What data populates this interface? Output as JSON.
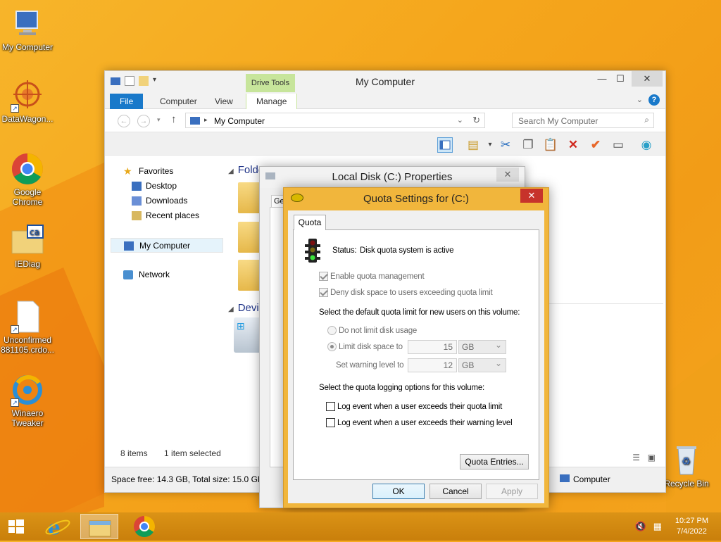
{
  "desktop": {
    "icons": [
      {
        "label": "My Computer"
      },
      {
        "label": "DataWagon..."
      },
      {
        "label": "Google Chrome"
      },
      {
        "label": "IEDiag"
      },
      {
        "label": "Unconfirmed 881105.crdo..."
      },
      {
        "label": "Winaero Tweaker"
      },
      {
        "label": "Recycle Bin"
      }
    ]
  },
  "explorer": {
    "title": "My Computer",
    "context_tab": "Drive Tools",
    "tabs": [
      "File",
      "Computer",
      "View",
      "Manage"
    ],
    "address": "My Computer",
    "search_placeholder": "Search My Computer",
    "nav": {
      "favorites": "Favorites",
      "desktop": "Desktop",
      "downloads": "Downloads",
      "recent": "Recent places",
      "computer": "My Computer",
      "network": "Network"
    },
    "groups": {
      "folders": "Folde",
      "devices": "Devi"
    },
    "status": {
      "items": "8 items",
      "selected": "1 item selected"
    },
    "footer": {
      "space": "Space free: 14.3 GB, Total size: 15.0 GB",
      "computer": "Computer"
    }
  },
  "properties_dialog": {
    "title": "Local Disk (C:) Properties",
    "tab_partial": "Ge"
  },
  "quota_dialog": {
    "title": "Quota Settings for  (C:)",
    "tab": "Quota",
    "status_label": "Status:",
    "status_value": "Disk quota system is active",
    "enable_label": "Enable quota management",
    "deny_label": "Deny disk space to users exceeding quota limit",
    "default_heading": "Select the default quota limit for new users on this volume:",
    "no_limit_label": "Do not limit disk usage",
    "limit_label": "Limit disk space to",
    "limit_value": "15",
    "limit_unit": "GB",
    "warning_label": "Set warning level to",
    "warning_value": "12",
    "warning_unit": "GB",
    "logging_heading": "Select the quota logging options for this volume:",
    "log_quota_label": "Log event when a user exceeds their quota limit",
    "log_warning_label": "Log event when a user exceeds their warning level",
    "entries_button": "Quota Entries...",
    "ok": "OK",
    "cancel": "Cancel",
    "apply": "Apply",
    "state": {
      "enable_checked": true,
      "deny_checked": true,
      "limit_selected": true,
      "log_quota_checked": false,
      "log_warning_checked": false
    }
  },
  "taskbar": {
    "time": "10:27 PM",
    "date": "7/4/2022"
  },
  "colors": {
    "desktop_bg": "#f5a61c",
    "file_tab": "#1979ca",
    "drive_tools": "#c7e59b",
    "quota_frame": "#f1b63c",
    "close_red": "#c7332b"
  }
}
